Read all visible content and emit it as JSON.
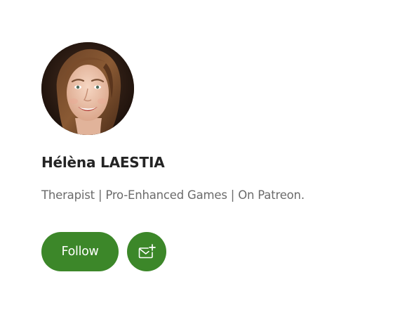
{
  "profile": {
    "name": "Hélèna LAESTIA",
    "bio": "Therapist | Pro-Enhanced Games | On Patreon.",
    "avatar_icon": "profile-photo"
  },
  "actions": {
    "follow_label": "Follow",
    "subscribe_icon": "mail-plus-icon"
  },
  "colors": {
    "accent": "#3c8729",
    "name_text": "#242424",
    "bio_text": "#6b6b6b",
    "background": "#ffffff"
  }
}
